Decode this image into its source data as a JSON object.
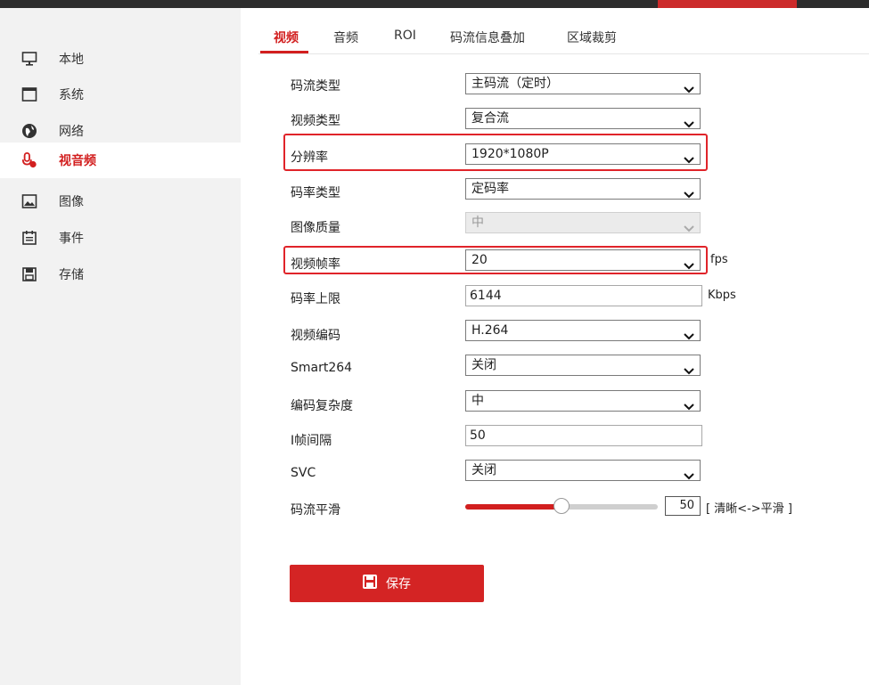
{
  "colors": {
    "accent": "#d21f1f",
    "sidebar_bg": "#f2f2f2",
    "highlight": "#e0242a"
  },
  "sidebar": {
    "items": [
      {
        "label": "本地",
        "icon": "monitor-icon"
      },
      {
        "label": "系统",
        "icon": "system-icon"
      },
      {
        "label": "网络",
        "icon": "globe-icon"
      },
      {
        "label": "视音频",
        "icon": "mic-camera-icon",
        "active": true
      },
      {
        "label": "图像",
        "icon": "image-icon"
      },
      {
        "label": "事件",
        "icon": "event-icon"
      },
      {
        "label": "存储",
        "icon": "storage-icon"
      }
    ]
  },
  "tabs": [
    {
      "label": "视频",
      "active": true
    },
    {
      "label": "音频"
    },
    {
      "label": "ROI"
    },
    {
      "label": "码流信息叠加"
    },
    {
      "label": "区域裁剪"
    }
  ],
  "form": {
    "stream_type": {
      "label": "码流类型",
      "value": "主码流（定时）"
    },
    "video_type": {
      "label": "视频类型",
      "value": "复合流"
    },
    "resolution": {
      "label": "分辨率",
      "value": "1920*1080P"
    },
    "bitrate_type": {
      "label": "码率类型",
      "value": "定码率"
    },
    "image_quality": {
      "label": "图像质量",
      "value": "中",
      "disabled": true
    },
    "frame_rate": {
      "label": "视频帧率",
      "value": "20",
      "unit": "fps"
    },
    "max_bitrate": {
      "label": "码率上限",
      "value": "6144",
      "unit": "Kbps"
    },
    "video_encoding": {
      "label": "视频编码",
      "value": "H.264"
    },
    "smart264": {
      "label": "Smart264",
      "value": "关闭"
    },
    "encoding_complexity": {
      "label": "编码复杂度",
      "value": "中"
    },
    "i_frame_interval": {
      "label": "I帧间隔",
      "value": "50"
    },
    "svc": {
      "label": "SVC",
      "value": "关闭"
    },
    "stream_smoothing": {
      "label": "码流平滑",
      "value": "50",
      "level": 0.5,
      "hint": "[ 清晰<->平滑 ]"
    }
  },
  "save_button": {
    "label": "保存",
    "icon": "save-icon"
  }
}
